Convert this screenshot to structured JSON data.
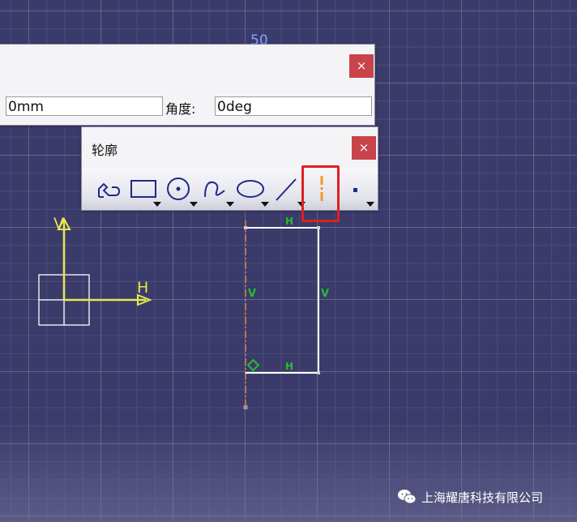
{
  "canvas": {
    "dimension_text": "50",
    "axis_labels": {
      "vertical": "V",
      "horizontal": "H"
    },
    "constraint_labels": {
      "top": "H",
      "bottom": "H",
      "left": "V",
      "right": "V"
    },
    "colors": {
      "background": "#3b3b6b",
      "axis": "#e8e84a",
      "construction_line": "#e07a3a",
      "constraint_text": "#22c02a",
      "highlight": "#e02020"
    }
  },
  "param_dialog": {
    "close_label": "×",
    "length_value": "0mm",
    "angle_label": "角度:",
    "angle_value": "0deg"
  },
  "profile_toolbar": {
    "title": "轮廓",
    "close_label": "×",
    "tools": [
      {
        "name": "profile",
        "icon": "profile-icon"
      },
      {
        "name": "rectangle",
        "icon": "rectangle-icon"
      },
      {
        "name": "circle",
        "icon": "circle-icon"
      },
      {
        "name": "spline",
        "icon": "spline-icon"
      },
      {
        "name": "ellipse",
        "icon": "ellipse-icon"
      },
      {
        "name": "line",
        "icon": "line-icon"
      },
      {
        "name": "axis",
        "icon": "axis-icon"
      },
      {
        "name": "point",
        "icon": "point-icon"
      }
    ]
  },
  "watermark": {
    "text": "上海耀唐科技有限公司",
    "icon": "wechat-icon"
  }
}
